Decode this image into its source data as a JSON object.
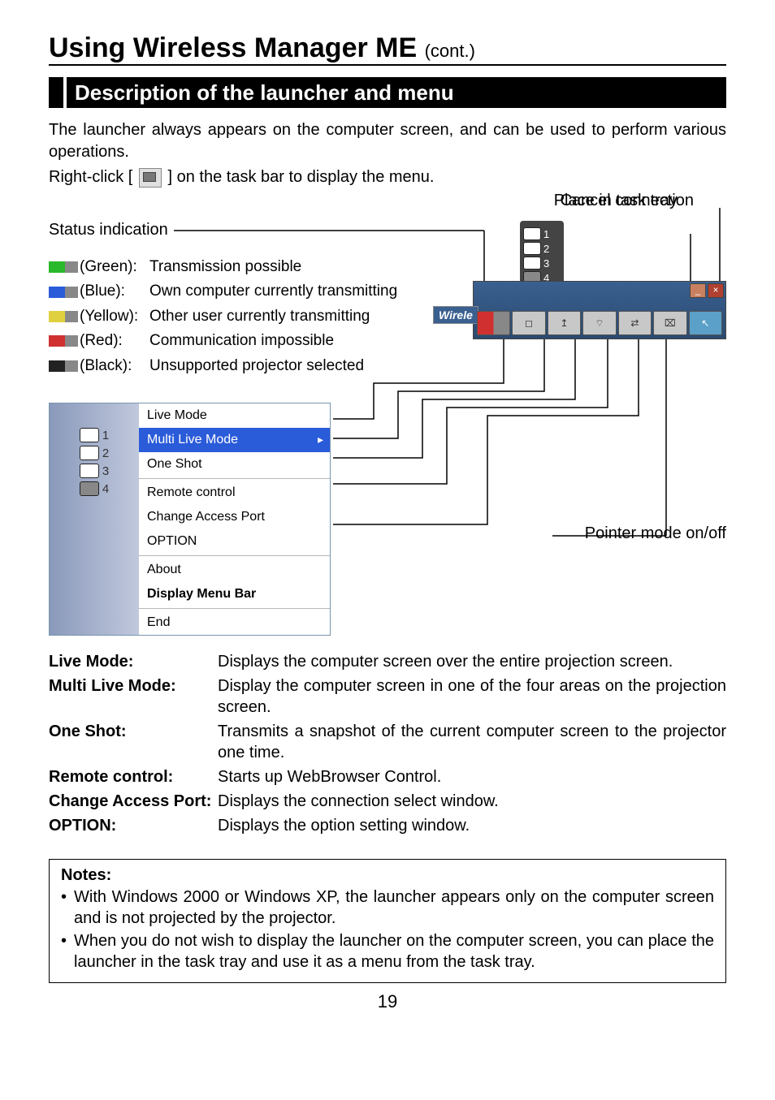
{
  "page": {
    "heading": "Using Wireless Manager ME",
    "heading_cont": "(cont.)",
    "section_title": "Description of the launcher and menu",
    "intro_line1": "The launcher always appears on the computer screen, and can be used to perform various operations.",
    "intro_line2_pre": "Right-click [",
    "intro_line2_post": "] on the task bar to display the menu.",
    "page_number": "19"
  },
  "callouts": {
    "cancel_connection": "Cancel connection",
    "place_in_tray": "Place in task tray",
    "status_indication": "Status indication",
    "pointer_mode": "Pointer mode on/off"
  },
  "status_colors": [
    {
      "color": "Green",
      "desc": "Transmission possible",
      "swatch": "sw-green"
    },
    {
      "color": "Blue",
      "desc": "Own computer currently transmitting",
      "swatch": "sw-blue"
    },
    {
      "color": "Yellow",
      "desc": "Other user currently transmitting",
      "swatch": "sw-yellow"
    },
    {
      "color": "Red",
      "desc": "Communication impossible",
      "swatch": "sw-red"
    },
    {
      "color": "Black",
      "desc": "Unsupported projector selected",
      "swatch": "sw-black"
    }
  ],
  "launcher": {
    "title_chip": "Wirele",
    "vertical_items": [
      "1",
      "2",
      "3",
      "4"
    ],
    "toolbar_btns": [
      "status",
      "mode",
      "select",
      "wifi",
      "ptr",
      "ctl",
      "quit"
    ],
    "top_min": "_",
    "top_close": "×"
  },
  "context_menu": {
    "left_items": [
      "1",
      "2",
      "3",
      "4"
    ],
    "items": [
      {
        "label": "Live Mode",
        "hi": false
      },
      {
        "label": "Multi Live Mode",
        "hi": true
      },
      {
        "label": "One Shot",
        "hi": false
      },
      {
        "sep": true
      },
      {
        "label": "Remote control",
        "hi": false
      },
      {
        "label": "Change Access Port",
        "hi": false
      },
      {
        "label": "OPTION",
        "hi": false
      },
      {
        "sep": true
      },
      {
        "label": "About",
        "hi": false
      },
      {
        "label": "Display Menu Bar",
        "hi": false,
        "bold": true
      },
      {
        "sep": true
      },
      {
        "label": "End",
        "hi": false
      }
    ]
  },
  "definitions": [
    {
      "term": "Live Mode:",
      "desc": "Displays the computer screen over the entire projection screen."
    },
    {
      "term": "Multi Live Mode:",
      "desc": "Display the computer screen in one of the four areas on the projection screen."
    },
    {
      "term": "One Shot:",
      "desc": "Transmits a snapshot of the current computer screen to the projector one time."
    },
    {
      "term": "Remote control:",
      "desc": "Starts up WebBrowser Control."
    },
    {
      "term": "Change Access Port:",
      "desc": "Displays the connection select window."
    },
    {
      "term": "OPTION:",
      "desc": "Displays the option setting window."
    }
  ],
  "notes": {
    "title": "Notes:",
    "items": [
      "With Windows 2000 or Windows XP, the launcher appears only on the computer screen and is not projected by the projector.",
      "When you do not wish to display the launcher on the computer screen, you can place the launcher in the task tray and use it as a menu from the task tray."
    ]
  }
}
